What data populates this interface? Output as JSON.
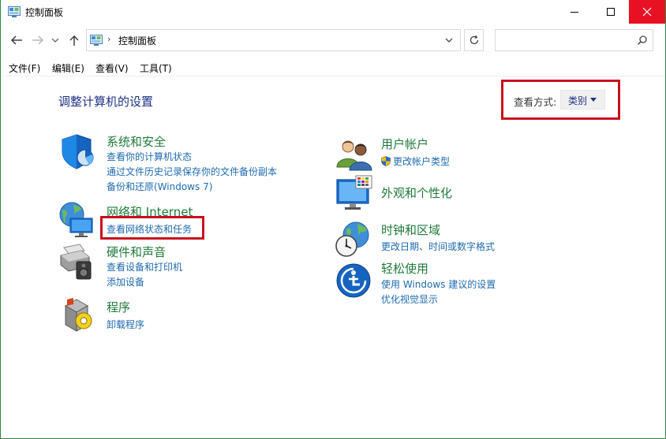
{
  "window": {
    "title": "控制面板"
  },
  "address": {
    "separator": "›",
    "path": "控制面板",
    "search_placeholder": ""
  },
  "menu": {
    "items": [
      "文件(F)",
      "编辑(E)",
      "查看(V)",
      "工具(T)"
    ]
  },
  "main": {
    "title": "调整计算机的设置",
    "view_by_label": "查看方式:",
    "view_by_value": "类别"
  },
  "categories": {
    "system": {
      "title": "系统和安全",
      "links": [
        "查看你的计算机状态",
        "通过文件历史记录保存你的文件备份副本",
        "备份和还原(Windows 7)"
      ]
    },
    "network": {
      "title": "网络和 Internet",
      "links": [
        "查看网络状态和任务"
      ]
    },
    "hardware": {
      "title": "硬件和声音",
      "links": [
        "查看设备和打印机",
        "添加设备"
      ]
    },
    "programs": {
      "title": "程序",
      "links": [
        "卸载程序"
      ]
    },
    "users": {
      "title": "用户帐户",
      "links": [
        "更改帐户类型"
      ]
    },
    "appearance": {
      "title": "外观和个性化",
      "links": []
    },
    "clock": {
      "title": "时钟和区域",
      "links": [
        "更改日期、时间或数字格式"
      ]
    },
    "ease": {
      "title": "轻松使用",
      "links": [
        "使用 Windows 建议的设置",
        "优化视觉显示"
      ]
    }
  },
  "colors": {
    "title_blue": "#1e3287",
    "category_green": "#1f7a3a",
    "link_blue": "#1e6ab0",
    "highlight_red": "#c8101e",
    "close_red": "#e81123"
  }
}
